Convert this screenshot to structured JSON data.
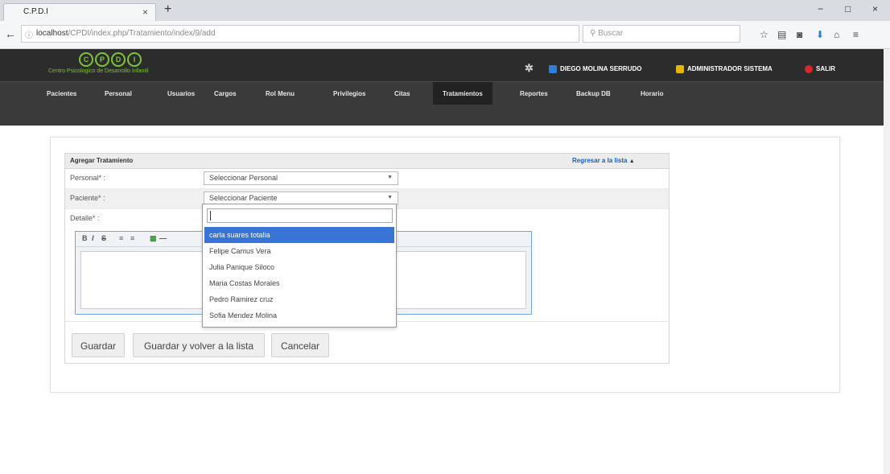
{
  "browser": {
    "tab_title": "C.P.D.I",
    "tab_close": "×",
    "new_tab": "+",
    "url_host": "localhost",
    "url_path": "/CPDI/index.php/Tratamiento/index/9/add",
    "reload": "C",
    "search_placeholder": "Buscar",
    "win_minimize": "−",
    "win_restore": "□",
    "win_close": "×",
    "toolbar_icons": [
      "star-icon",
      "clipboard-icon",
      "pocket-icon",
      "download-icon",
      "home-icon",
      "menu-icon"
    ]
  },
  "header": {
    "logo_letters": [
      "C",
      "P",
      "D",
      "I"
    ],
    "logo_subtitle": "Centro Psicologico de Desarrollo Infantil",
    "user_name": "DIEGO MOLINA SERRUDO",
    "role": "ADMINISTRADOR SISTEMA",
    "logout": "SALIR",
    "colors": {
      "accent": "#7cc43a",
      "header_bg": "#2c2c2c",
      "nav_bg": "#3a3a3a",
      "link": "#1a5fb4",
      "highlight": "#3875d7"
    }
  },
  "nav": {
    "items": [
      "Pacientes",
      "Personal",
      "Usuarios",
      "Cargos",
      "Rol Menu",
      "Privilegios",
      "Citas",
      "Tratamientos",
      "Reportes",
      "Backup DB",
      "Horario"
    ],
    "active": "Tratamientos"
  },
  "form": {
    "title": "Agregar Tratamiento",
    "back_link": "Regresar a la lista",
    "back_caret": "▲",
    "fields": {
      "personal_label": "Personal* :",
      "personal_value": "Seleccionar Personal",
      "paciente_label": "Paciente* :",
      "paciente_value": "Seleccionar Paciente",
      "detalle_label": "Detalle* :"
    },
    "editor_toolbar": [
      "B",
      "I",
      "S",
      "≡",
      "≡",
      "▦",
      "—"
    ],
    "buttons": {
      "save": "Guardar",
      "save_back": "Guardar y volver a la lista",
      "cancel": "Cancelar"
    }
  },
  "dropdown": {
    "search_value": "",
    "options": [
      "carla suares totalia",
      "Felipe Camus Vera",
      "Julia Panique Siloco",
      "Maria Costas Morales",
      "Pedro Ramirez cruz",
      "Sofia Mendez Molina"
    ],
    "highlighted_index": 0
  }
}
